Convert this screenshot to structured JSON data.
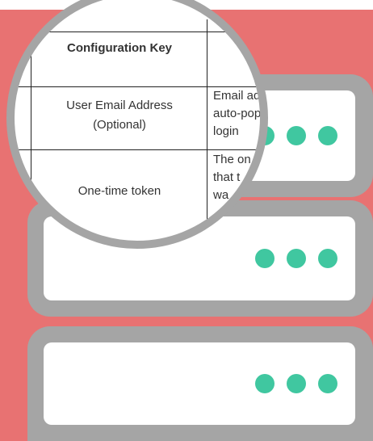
{
  "colors": {
    "background": "#e87272",
    "server_frame": "#a5a5a5",
    "server_panel": "#ffffff",
    "status_dot": "#40c7a0"
  },
  "table": {
    "header": "Configuration Key",
    "rows": [
      {
        "key_line1": "User Email Address",
        "key_line2": "(Optional)",
        "desc_lines": [
          "Email ad",
          "auto-pop",
          "login"
        ]
      },
      {
        "key_line1": "One-time token",
        "desc_lines": [
          "The on",
          "that t",
          "wa"
        ]
      }
    ]
  },
  "servers": [
    {
      "status_dots": 3
    },
    {
      "status_dots": 3
    },
    {
      "status_dots": 3
    }
  ]
}
